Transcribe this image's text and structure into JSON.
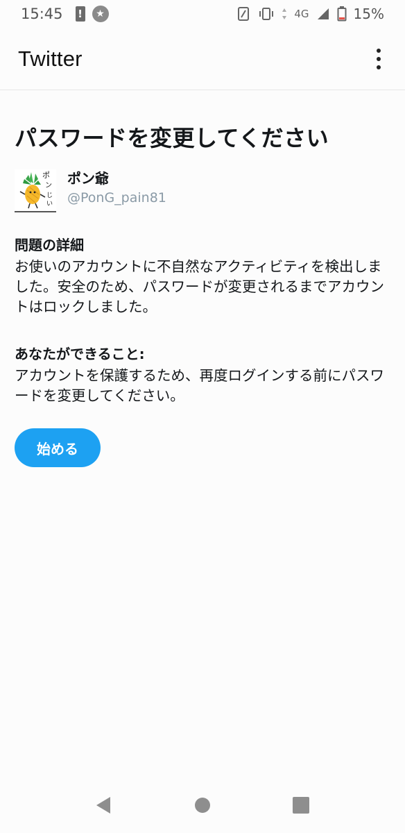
{
  "status_bar": {
    "time": "15:45",
    "network": "4G",
    "battery": "15%",
    "icons": [
      "notification-alert-icon",
      "star-badge-icon",
      "nfc-icon",
      "vibrate-icon",
      "data-arrows-icon",
      "signal-icon",
      "battery-icon"
    ]
  },
  "app_bar": {
    "title": "Twitter",
    "overflow_icon": "more-vertical-icon"
  },
  "page": {
    "title": "パスワードを変更してください"
  },
  "account": {
    "display_name": "ポン爺",
    "handle": "@PonG_pain81",
    "avatar_icon": "pineapple-avatar"
  },
  "details": {
    "heading": "問題の詳細",
    "body": "お使いのアカウントに不自然なアクティビティを検出しました。安全のため、パスワードが変更されるまでアカウントはロックしました。"
  },
  "actions": {
    "heading": "あなたができること:",
    "body": "アカウントを保護するため、再度ログインする前にパスワードを変更してください。"
  },
  "start_button": {
    "label": "始める"
  },
  "colors": {
    "accent": "#1da1f2",
    "text": "#14171a",
    "handle": "#8a9aa6"
  },
  "nav": {
    "icons": [
      "back-icon",
      "home-icon",
      "recents-icon"
    ]
  }
}
